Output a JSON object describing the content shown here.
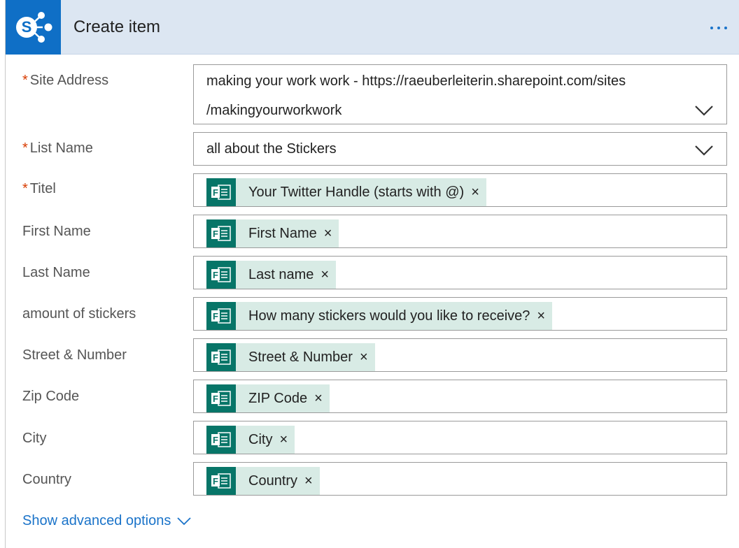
{
  "header": {
    "title": "Create item",
    "logo_letter": "S",
    "accent": "#0f6fc6"
  },
  "fields": {
    "site_address": {
      "label": "Site Address",
      "required": "*",
      "value_line1": "making your work work - https://raeuberleiterin.sharepoint.com/sites",
      "value_line2": "/makingyourworkwork"
    },
    "list_name": {
      "label": "List Name",
      "required": "*",
      "value": "all about the Stickers"
    },
    "titel": {
      "label": "Titel",
      "required": "*",
      "token": "Your Twitter Handle (starts with @)"
    },
    "first_name": {
      "label": "First Name",
      "token": "First Name"
    },
    "last_name": {
      "label": "Last Name",
      "token": "Last name"
    },
    "amount": {
      "label": "amount of stickers",
      "token": "How many stickers would you like to receive?"
    },
    "street": {
      "label": "Street & Number",
      "token": "Street & Number"
    },
    "zip": {
      "label": "Zip Code",
      "token": "ZIP Code"
    },
    "city": {
      "label": "City",
      "token": "City"
    },
    "country": {
      "label": "Country",
      "token": "Country"
    }
  },
  "token_close": "×",
  "token_icon": "forms-icon",
  "advanced": {
    "label": "Show advanced options"
  }
}
